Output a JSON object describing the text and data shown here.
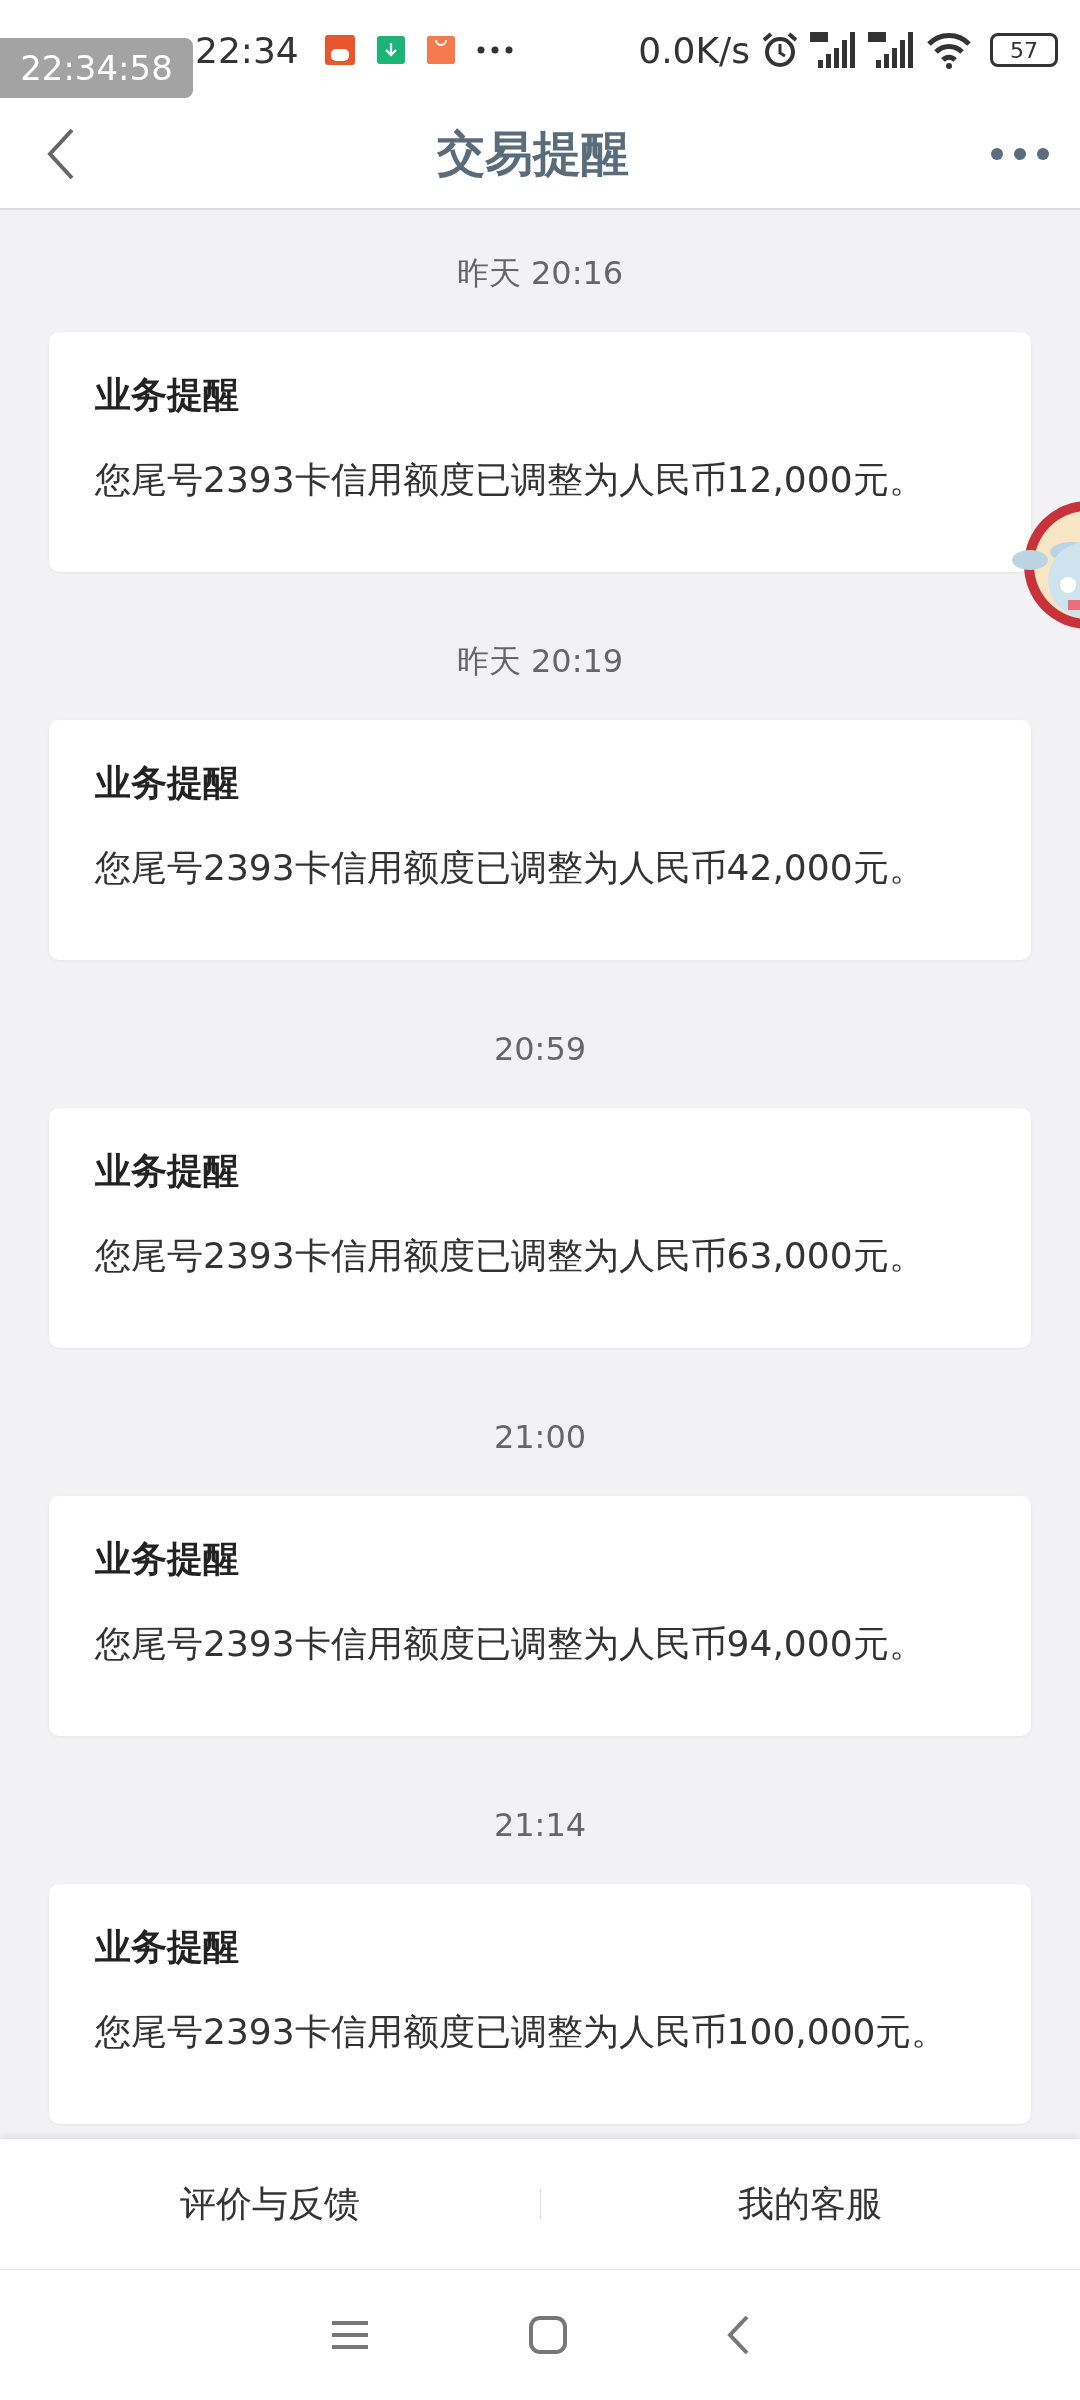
{
  "status_bar": {
    "overlay_clock": "22:34:58",
    "time": "22:34",
    "network_speed": "0.0K/s",
    "battery": "57"
  },
  "header": {
    "title": "交易提醒"
  },
  "messages": [
    {
      "time": "昨天 20:16",
      "title": "业务提醒",
      "body": "您尾号2393卡信用额度已调整为人民币12,000元。"
    },
    {
      "time": "昨天 20:19",
      "title": "业务提醒",
      "body": "您尾号2393卡信用额度已调整为人民币42,000元。"
    },
    {
      "time": "20:59",
      "title": "业务提醒",
      "body": "您尾号2393卡信用额度已调整为人民币63,000元。"
    },
    {
      "time": "21:00",
      "title": "业务提醒",
      "body": "您尾号2393卡信用额度已调整为人民币94,000元。"
    },
    {
      "time": "21:14",
      "title": "业务提醒",
      "body": "您尾号2393卡信用额度已调整为人民币100,000元。"
    }
  ],
  "footer_buttons": [
    "评价与反馈",
    "我的客服"
  ]
}
